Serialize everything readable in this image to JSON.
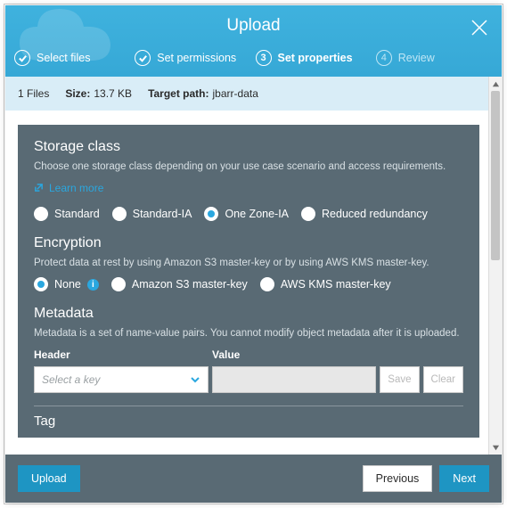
{
  "header": {
    "title": "Upload",
    "steps": [
      {
        "label": "Select files",
        "state": "done"
      },
      {
        "label": "Set permissions",
        "state": "done"
      },
      {
        "label": "Set properties",
        "state": "current",
        "num": "3"
      },
      {
        "label": "Review",
        "state": "pending",
        "num": "4"
      }
    ]
  },
  "info_bar": {
    "files": "1 Files",
    "size_label": "Size:",
    "size_value": "13.7 KB",
    "target_label": "Target path:",
    "target_value": "jbarr-data"
  },
  "storage": {
    "heading": "Storage class",
    "sub": "Choose one storage class depending on your use case scenario and access requirements.",
    "learn": "Learn more",
    "options": [
      "Standard",
      "Standard-IA",
      "One Zone-IA",
      "Reduced redundancy"
    ],
    "selected": 2
  },
  "encryption": {
    "heading": "Encryption",
    "sub": "Protect data at rest by using Amazon S3 master-key or by using AWS KMS master-key.",
    "options": [
      "None",
      "Amazon S3 master-key",
      "AWS KMS master-key"
    ],
    "selected": 0
  },
  "metadata": {
    "heading": "Metadata",
    "sub": "Metadata is a set of name-value pairs. You cannot modify object metadata after it is uploaded.",
    "col_header": "Header",
    "col_value": "Value",
    "placeholder": "Select a key",
    "save": "Save",
    "clear": "Clear"
  },
  "tag": {
    "heading": "Tag"
  },
  "footer": {
    "upload": "Upload",
    "previous": "Previous",
    "next": "Next"
  }
}
